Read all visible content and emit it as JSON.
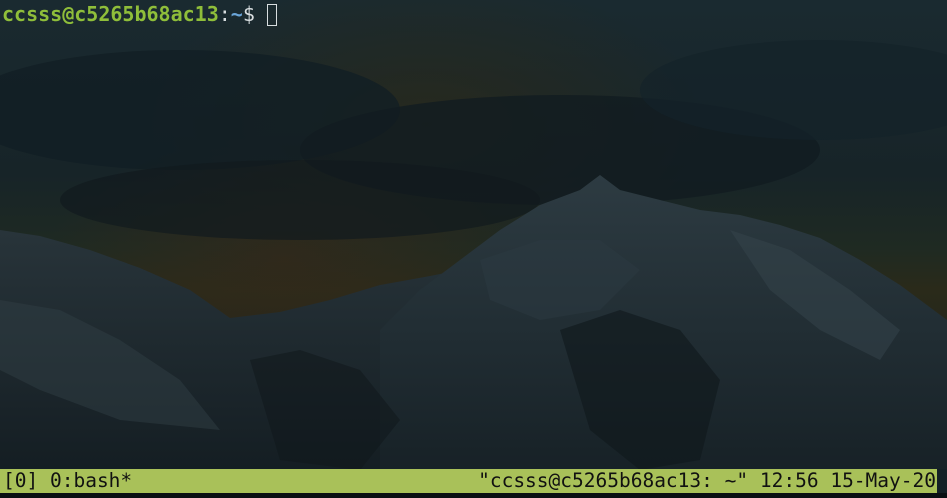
{
  "terminal": {
    "prompt_user_host": "ccsss@c5265b68ac13",
    "prompt_colon": ":",
    "prompt_path": "~",
    "prompt_symbol": "$"
  },
  "statusbar": {
    "session": "[0]",
    "window": "0:bash*",
    "pane_title": "\"ccsss@c5265b68ac13: ~\"",
    "time": "12:56",
    "date": "15-May-20"
  },
  "colors": {
    "statusbar_bg": "#a9c159",
    "prompt_user": "#8fbe3a",
    "prompt_path": "#6aa5d8",
    "background": "#0f1a1f"
  }
}
